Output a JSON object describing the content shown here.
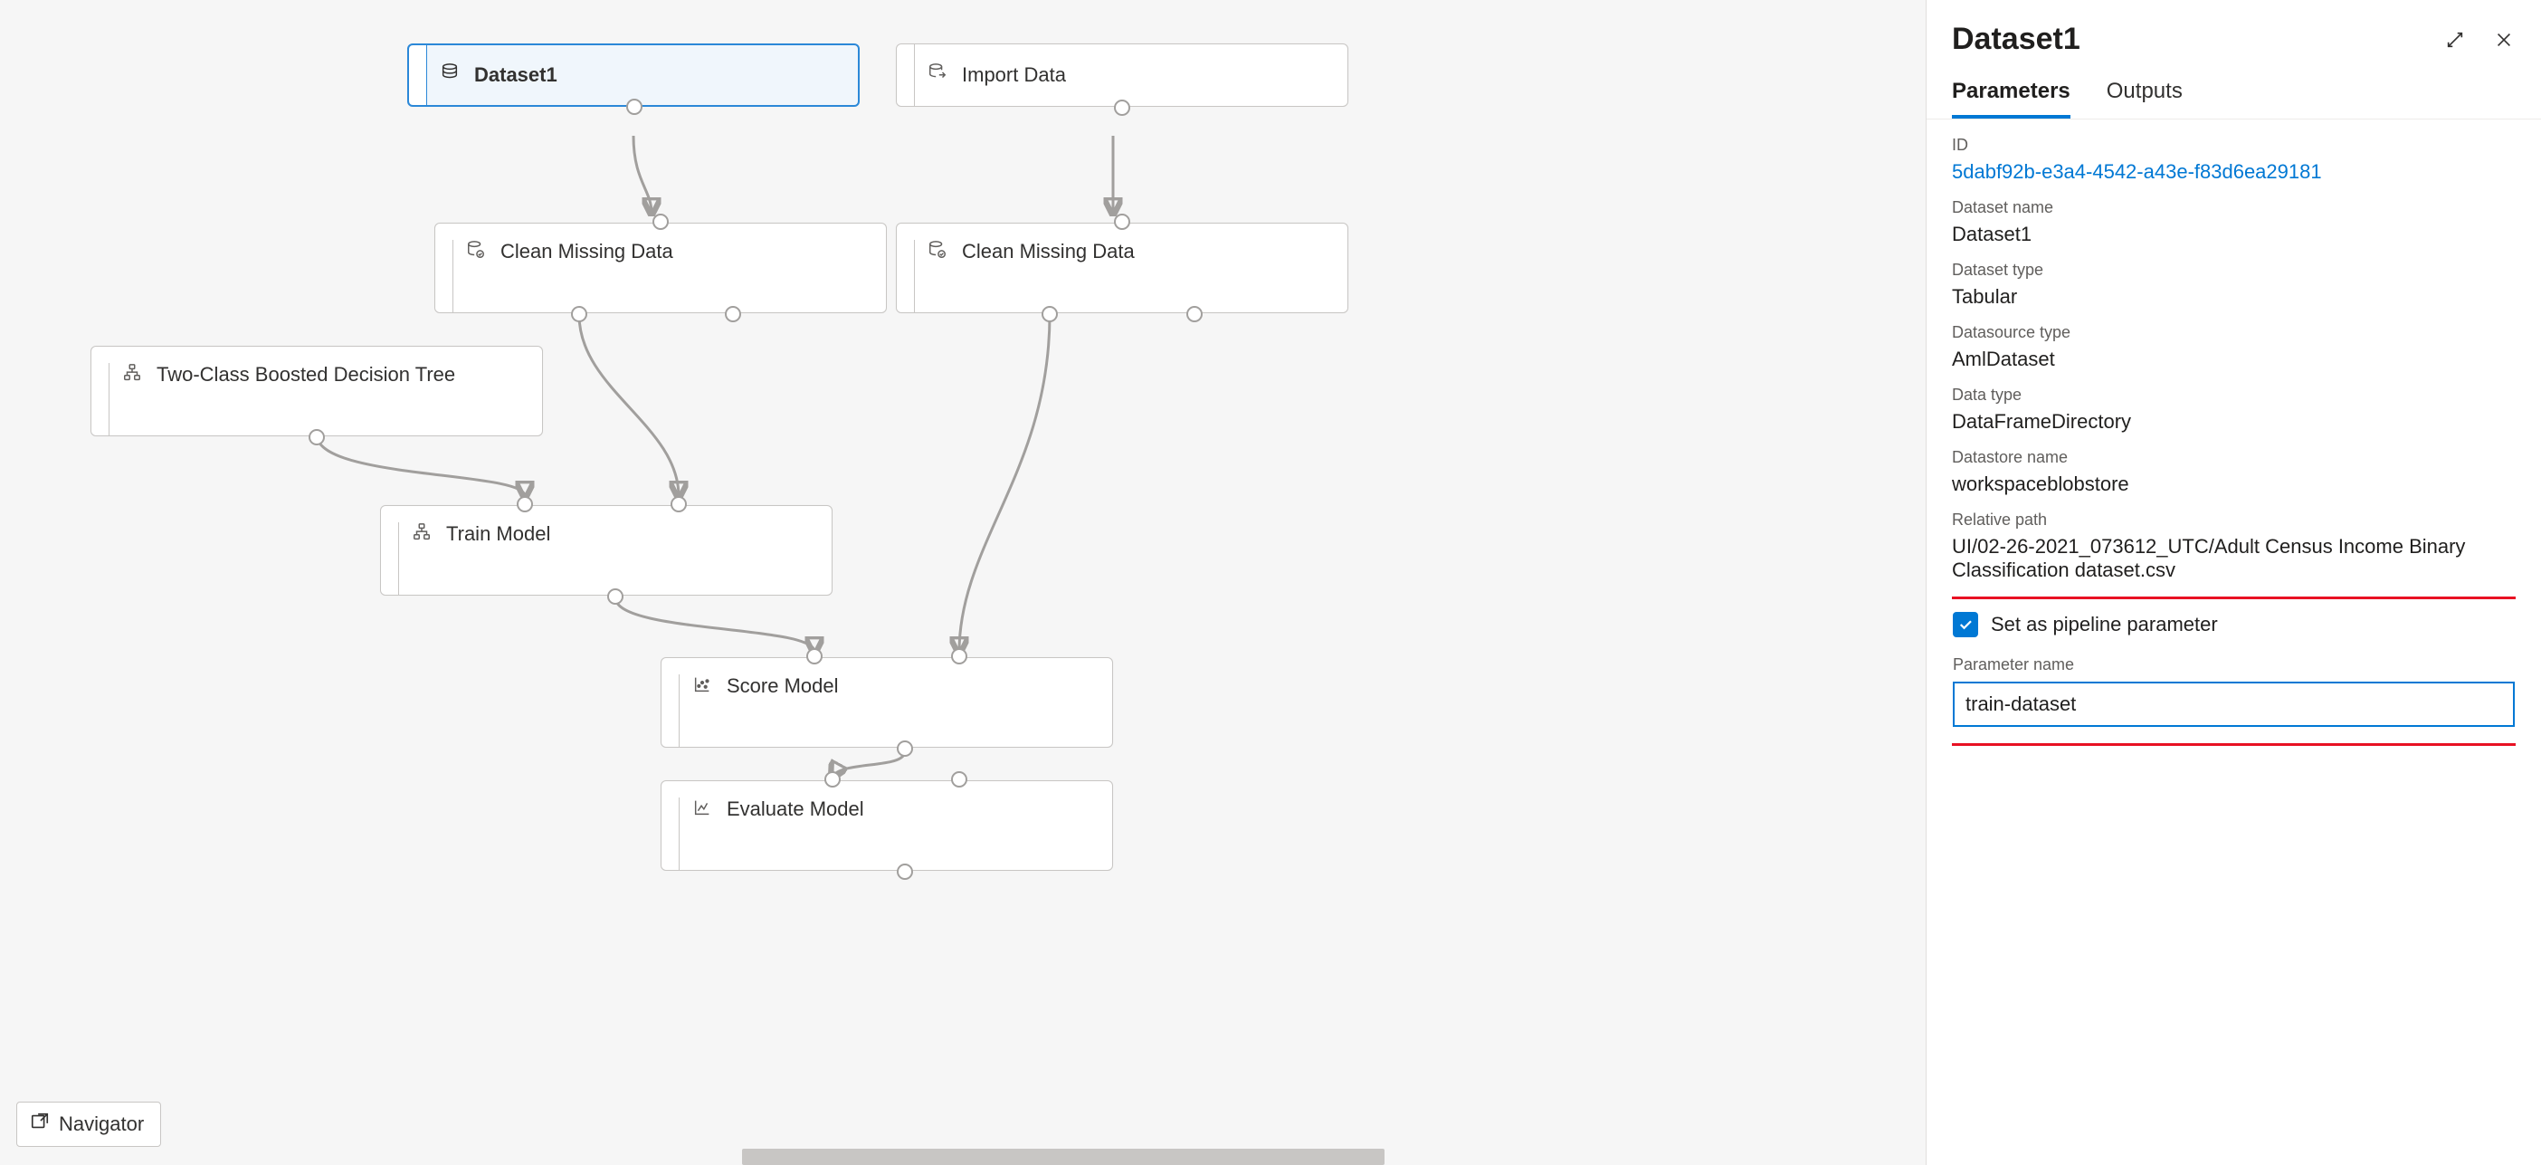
{
  "canvas": {
    "nodes": {
      "dataset1": "Dataset1",
      "import_data": "Import Data",
      "clean_missing_left": "Clean Missing Data",
      "clean_missing_right": "Clean Missing Data",
      "two_class_tree": "Two-Class Boosted Decision Tree",
      "train_model": "Train Model",
      "score_model": "Score Model",
      "evaluate_model": "Evaluate Model"
    },
    "navigator_label": "Navigator"
  },
  "panel": {
    "title": "Dataset1",
    "tabs": {
      "parameters": "Parameters",
      "outputs": "Outputs"
    },
    "props": {
      "id_label": "ID",
      "id_value": "5dabf92b-e3a4-4542-a43e-f83d6ea29181",
      "dataset_name_label": "Dataset name",
      "dataset_name_value": "Dataset1",
      "dataset_type_label": "Dataset type",
      "dataset_type_value": "Tabular",
      "datasource_type_label": "Datasource type",
      "datasource_type_value": "AmlDataset",
      "data_type_label": "Data type",
      "data_type_value": "DataFrameDirectory",
      "datastore_name_label": "Datastore name",
      "datastore_name_value": "workspaceblobstore",
      "relative_path_label": "Relative path",
      "relative_path_value": "UI/02-26-2021_073612_UTC/Adult Census Income Binary Classification dataset.csv"
    },
    "parameter_box": {
      "checkbox_label": "Set as pipeline parameter",
      "param_name_label": "Parameter name",
      "param_name_value": "train-dataset"
    }
  }
}
